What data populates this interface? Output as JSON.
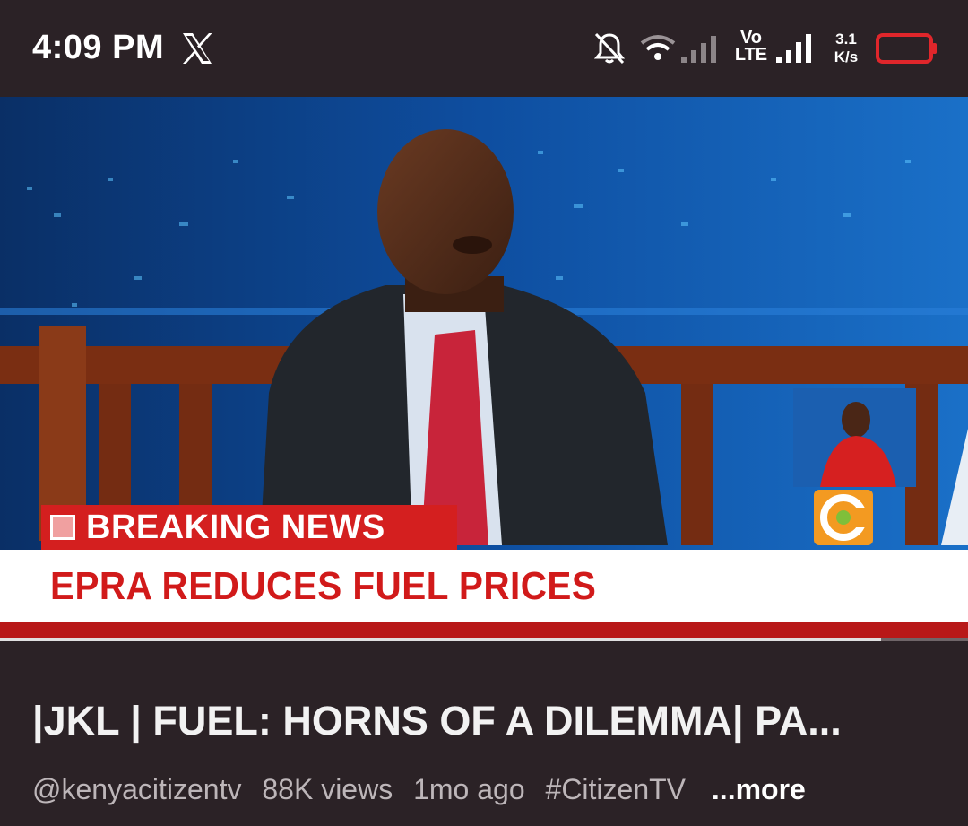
{
  "status_bar": {
    "time": "4:09 PM",
    "app_icon": "x-logo-icon",
    "volte_top": "Vo",
    "volte_bottom": "LTE",
    "net_speed_value": "3.1",
    "net_speed_unit": "K/s",
    "icons": [
      "notifications-off-icon",
      "wifi-icon",
      "cell-signal-icon",
      "battery-icon"
    ],
    "battery_color": "#e0262b"
  },
  "video": {
    "breaking_label": "BREAKING NEWS",
    "headline": "EPRA REDUCES FUEL PRICES",
    "channel_logo": "citizen-tv-logo-icon",
    "progress_fraction": 0.91,
    "colors": {
      "breaking_red": "#d41f1f",
      "headline_red": "#d11a1a",
      "studio_blue": "#0b3a78"
    }
  },
  "info": {
    "title": "|JKL | FUEL: HORNS OF A DILEMMA| PA...",
    "channel": "@kenyacitizentv",
    "views": "88K views",
    "age": "1mo ago",
    "hashtag": "#CitizenTV",
    "more_label": "...more"
  }
}
